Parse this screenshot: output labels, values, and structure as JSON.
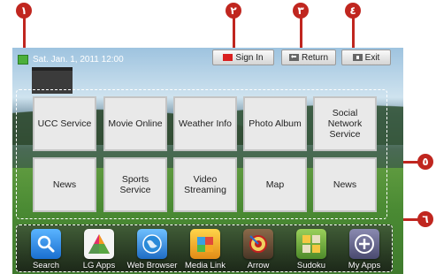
{
  "markers": [
    "١",
    "٢",
    "٣",
    "٤",
    "٥",
    "٦"
  ],
  "status": {
    "datetime": "Sat. Jan. 1, 2011  12:00"
  },
  "top_buttons": {
    "sign_in": "Sign In",
    "return": "Return",
    "exit": "Exit"
  },
  "colors": {
    "marker": "#c0261f",
    "sign_in_key": "#d92020",
    "status_indicator": "#4caf3b"
  },
  "tiles": [
    "UCC Service",
    "Movie Online",
    "Weather Info",
    "Photo Album",
    "Social Network Service",
    "News",
    "Sports Service",
    "Video Streaming",
    "Map",
    "News"
  ],
  "dock": [
    {
      "label": "Search",
      "icon": "search-icon"
    },
    {
      "label": "LG Apps",
      "icon": "lg-apps-icon"
    },
    {
      "label": "Web Browser",
      "icon": "globe-icon"
    },
    {
      "label": "Media Link",
      "icon": "media-link-icon"
    },
    {
      "label": "Arrow",
      "icon": "arrow-game-icon"
    },
    {
      "label": "Sudoku",
      "icon": "sudoku-icon"
    },
    {
      "label": "My Apps",
      "icon": "plus-icon"
    }
  ]
}
